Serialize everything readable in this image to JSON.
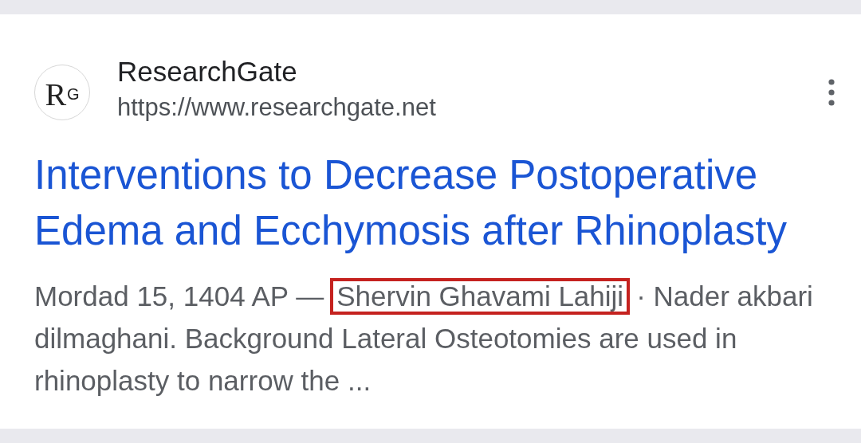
{
  "result": {
    "logo": "R$^{G}$",
    "site_name": "ResearchGate",
    "url": "https://www.researchgate.net",
    "title": "Interventions to Decrease Postoperative Edema and Ecchymosis after Rhinoplasty",
    "snippet_lines": [
      [
        {
          "text": "Mordad 15, 1404 AP —",
          "highlighted": false
        },
        {
          "text": "Shervin Ghavami Lahiji",
          "highlighted": true
        },
        {
          "text": "· Nader akbari",
          "highlighted": false
        }
      ],
      [
        {
          "text": "dilmaghani. Background Lateral Osteotomies are used in",
          "highlighted": false
        }
      ],
      [
        {
          "text": "rhinoplasty to narrow the ...",
          "highlighted": false
        }
      ]
    ]
  }
}
